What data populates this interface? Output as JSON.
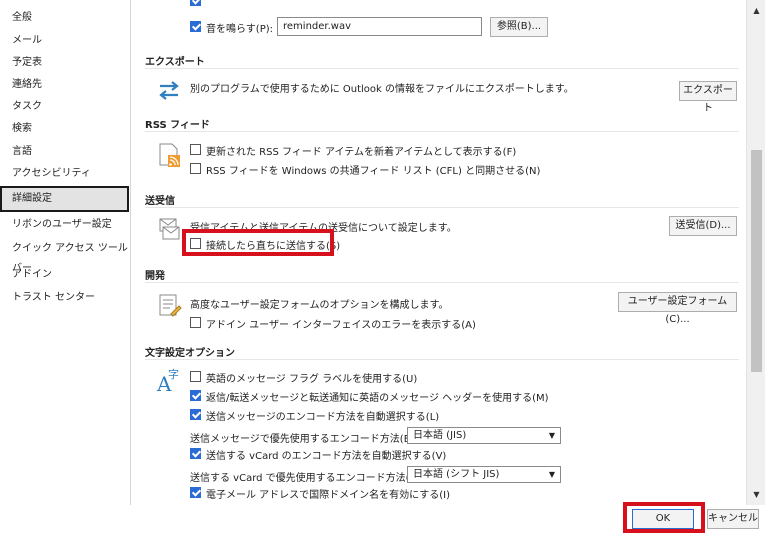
{
  "sidebar": {
    "items": [
      {
        "label": "全般"
      },
      {
        "label": "メール"
      },
      {
        "label": "予定表"
      },
      {
        "label": "連絡先"
      },
      {
        "label": "タスク"
      },
      {
        "label": "検索"
      },
      {
        "label": "言語"
      },
      {
        "label": "アクセシビリティ"
      },
      {
        "label": "詳細設定"
      },
      {
        "label": "リボンのユーザー設定"
      },
      {
        "label": "クイック アクセス ツール バー"
      },
      {
        "label": "アドイン"
      },
      {
        "label": "トラスト センター"
      }
    ],
    "selected": "詳細設定"
  },
  "top": {
    "sound_label": "音を鳴らす(P):",
    "sound_file": "reminder.wav",
    "browse_button": "参照(B)..."
  },
  "export": {
    "title": "エクスポート",
    "description": "別のプログラムで使用するために Outlook の情報をファイルにエクスポートします。",
    "button": "エクスポート"
  },
  "rss": {
    "title": "RSS フィード",
    "opt1": "更新された RSS フィード アイテムを新着アイテムとして表示する(F)",
    "opt2": "RSS フィードを Windows の共通フィード リスト (CFL) と同期させる(N)"
  },
  "sendrecv": {
    "title": "送受信",
    "description": "受信アイテムと送信アイテムの送受信について設定します。",
    "button": "送受信(D)...",
    "opt1": "接続したら直ちに送信する(S)"
  },
  "dev": {
    "title": "開発",
    "description": "高度なユーザー設定フォームのオプションを構成します。",
    "button": "ユーザー設定フォーム(C)...",
    "opt1": "アドイン ユーザー インターフェイスのエラーを表示する(A)"
  },
  "intl": {
    "title": "文字設定オプション",
    "opt1": "英語のメッセージ フラグ ラベルを使用する(U)",
    "opt2": "返信/転送メッセージと転送通知に英語のメッセージ ヘッダーを使用する(M)",
    "opt3": "送信メッセージのエンコード方法を自動選択する(L)",
    "encoding_label": "送信メッセージで優先使用するエンコード方法(E):",
    "encoding_value": "日本語 (JIS)",
    "opt4": "送信する vCard のエンコード方法を自動選択する(V)",
    "vcard_label": "送信する vCard で優先使用するエンコード方法(R):",
    "vcard_value": "日本語 (シフト JIS)",
    "opt5": "電子メール アドレスで国際ドメイン名を有効にする(I)"
  },
  "footer": {
    "ok": "OK",
    "cancel": "キャンセル"
  },
  "colors": {
    "highlight": "#d6101c",
    "check": "#2b6bd6"
  }
}
